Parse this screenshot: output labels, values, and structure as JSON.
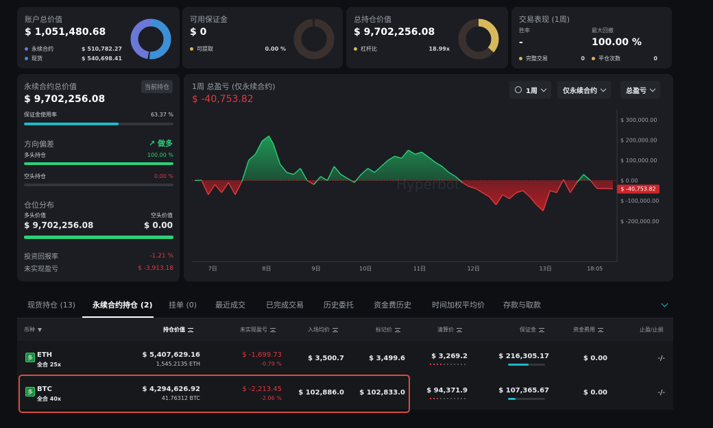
{
  "summary": {
    "account": {
      "label": "账户总价值",
      "value": "$ 1,051,480.68",
      "legend": [
        {
          "label": "永续合约",
          "value": "$ 510,782.27",
          "color": "#6b78d8"
        },
        {
          "label": "现货",
          "value": "$ 540,698.41",
          "color": "#3d8fd6"
        }
      ]
    },
    "margin": {
      "label": "可用保证金",
      "value": "$ 0",
      "legend_label": "可提取",
      "legend_value": "0.00 %",
      "legend_color": "#d9b85b"
    },
    "holdings": {
      "label": "总持仓价值",
      "value": "$ 9,702,256.08",
      "legend_label": "杠杆比",
      "legend_value": "18.99x",
      "legend_color": "#d9b85b"
    },
    "performance": {
      "label": "交易表现 (1周)",
      "winrate_label": "胜率",
      "winrate_value": "-",
      "drawdown_label": "最大回撤",
      "drawdown_value": "100.00 %",
      "completed_label": "完整交易",
      "completed_value": "0",
      "close_label": "平仓次数",
      "close_value": "0"
    }
  },
  "perp": {
    "label": "永续合约总价值",
    "current_btn": "当前持仓",
    "value": "$ 9,702,256.08",
    "margin_usage_label": "保证金使用率",
    "margin_usage_value": "63.37 %",
    "margin_usage_fraction": 0.6337,
    "direction_label": "方向偏差",
    "direction_value": "做多",
    "long_label": "多头持仓",
    "long_value": "100.00 %",
    "long_fraction": 1.0,
    "short_label": "空头持仓",
    "short_value": "0.00 %",
    "short_fraction": 0.0,
    "dist_label": "仓位分布",
    "long_worth_label": "多头价值",
    "short_worth_label": "空头价值",
    "long_worth": "$ 9,702,256.08",
    "short_worth": "$ 0.00",
    "roi_label": "投资回报率",
    "roi_value": "-1.21 %",
    "upnl_label": "未实现盈亏",
    "upnl_value": "$ -3,913.18"
  },
  "pnl_chart": {
    "title": "1周 总盈亏 (仅永续合约)",
    "value": "$ -40,753.82",
    "dropdowns": [
      "1周",
      "仅永续合约",
      "总盈亏"
    ],
    "watermark": "Hyperbot",
    "current_label": "$ -40,753.82"
  },
  "chart_data": {
    "type": "area",
    "title": "1周 总盈亏 (仅永续合约)",
    "ylim": [
      -380000,
      330000
    ],
    "yticks": [
      300000,
      200000,
      100000,
      0,
      -100000,
      -200000
    ],
    "ytick_labels": [
      "$ 300,000.00",
      "$ 200,000.00",
      "$ 100,000.00",
      "$ 0.00",
      "$ -100,000.00",
      "$ -200,000.00"
    ],
    "xtick_labels": [
      "7日",
      "8日",
      "9日",
      "10日",
      "11日",
      "12日",
      "13日",
      "18:05"
    ],
    "xtick_positions": [
      4,
      16,
      27,
      38,
      50,
      62,
      78,
      89
    ],
    "x": [
      0,
      1.5,
      3,
      4.5,
      6,
      7.5,
      9,
      10.5,
      12,
      13.5,
      15,
      16.5,
      17.5,
      19,
      20.5,
      22,
      23.5,
      25,
      26.5,
      28,
      29.5,
      31,
      32.5,
      34,
      35.5,
      37,
      38.5,
      40,
      41.5,
      43,
      44.5,
      46,
      47.5,
      49,
      50.5,
      52,
      53.5,
      55,
      56.5,
      58,
      59.5,
      61,
      62.5,
      64,
      65.5,
      67,
      68.5,
      70,
      71.5,
      73,
      74.5,
      76,
      77.5,
      79,
      80.5,
      82,
      83.5,
      85,
      86.5,
      88,
      89.5,
      91,
      93
    ],
    "values": [
      0,
      2000,
      -70000,
      -20000,
      -60000,
      -10000,
      -70000,
      -5000,
      100000,
      130000,
      195000,
      220000,
      180000,
      80000,
      40000,
      30000,
      60000,
      0,
      -20000,
      20000,
      0,
      70000,
      30000,
      10000,
      -10000,
      30000,
      60000,
      40000,
      70000,
      100000,
      120000,
      110000,
      150000,
      130000,
      140000,
      115000,
      90000,
      70000,
      40000,
      20000,
      -10000,
      -30000,
      -40000,
      -60000,
      -80000,
      -120000,
      -70000,
      -90000,
      -60000,
      -50000,
      -80000,
      -120000,
      -150000,
      -50000,
      -60000,
      5000,
      -60000,
      -10000,
      30000,
      0,
      -40000,
      -40000,
      -40753
    ]
  },
  "tabs": [
    {
      "label": "现货持仓 (13)",
      "active": false
    },
    {
      "label": "永续合约持仓 (2)",
      "active": true
    },
    {
      "label": "挂单 (0)",
      "active": false
    },
    {
      "label": "最近成交",
      "active": false
    },
    {
      "label": "已完成交易",
      "active": false
    },
    {
      "label": "历史委托",
      "active": false
    },
    {
      "label": "资金费历史",
      "active": false
    },
    {
      "label": "时间加权平均价",
      "active": false
    },
    {
      "label": "存款与取款",
      "active": false
    }
  ],
  "table": {
    "headers": [
      "币种",
      "持仓价值",
      "未实现盈亏",
      "入场均价",
      "标记价",
      "清算价",
      "保证金",
      "资金费用",
      "止盈/止损"
    ],
    "rows": [
      {
        "badge": "多",
        "coin": "ETH",
        "mode": "全合 25x",
        "value": "$ 5,407,629.16",
        "size": "1,545.2135 ETH",
        "upnl": "$ -1,699.73",
        "upnl_pct": "-0.79 %",
        "entry": "$ 3,500.7",
        "mark": "$ 3,499.6",
        "liq": "$ 3,269.2",
        "margin": "$ 216,305.17",
        "margin_fraction": 0.55,
        "funding": "$ 0.00",
        "tpsl": "-/-"
      },
      {
        "badge": "多",
        "coin": "BTC",
        "mode": "全合 40x",
        "value": "$ 4,294,626.92",
        "size": "41.76312 BTC",
        "upnl": "$ -2,213.45",
        "upnl_pct": "-2.06 %",
        "entry": "$ 102,886.0",
        "mark": "$ 102,833.0",
        "liq": "$ 94,371.9",
        "margin": "$ 107,365.67",
        "margin_fraction": 0.2,
        "funding": "$ 0.00",
        "tpsl": "-/-"
      }
    ]
  }
}
